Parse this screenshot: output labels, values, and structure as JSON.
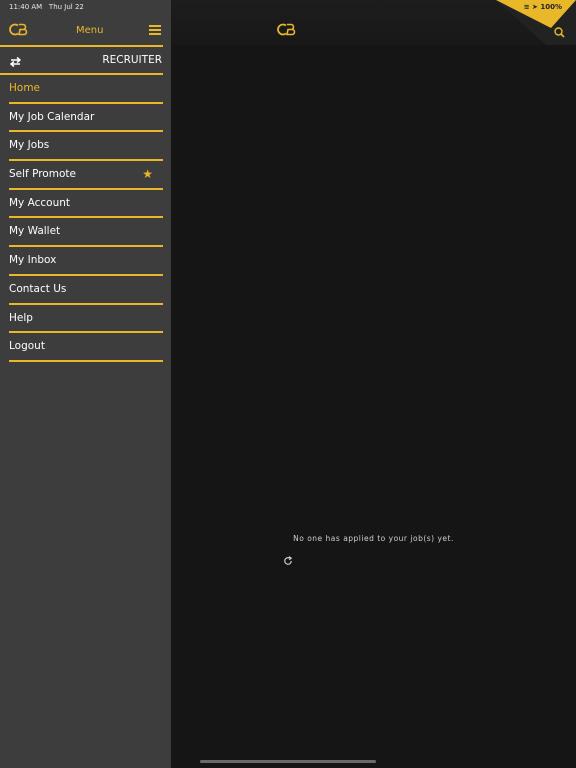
{
  "status_bar": {
    "time": "11:40 AM",
    "date": "Thu Jul 22",
    "battery": "100%"
  },
  "sidebar": {
    "logo": "CB",
    "menu_title": "Menu",
    "role_label": "RECRUITER",
    "items": [
      {
        "label": "Home",
        "active": true
      },
      {
        "label": "My Job Calendar"
      },
      {
        "label": "My Jobs"
      },
      {
        "label": "Self Promote",
        "icon": "star-icon"
      },
      {
        "label": "My Account"
      },
      {
        "label": "My Wallet"
      },
      {
        "label": "My Inbox"
      },
      {
        "label": "Contact Us"
      },
      {
        "label": "Help"
      },
      {
        "label": "Logout"
      }
    ]
  },
  "main": {
    "logo": "CB",
    "empty_message": "No one has applied to your job(s) yet."
  },
  "colors": {
    "accent": "#e8b82a",
    "sidebar_bg": "#3d3d3d",
    "main_bg": "#151515"
  }
}
